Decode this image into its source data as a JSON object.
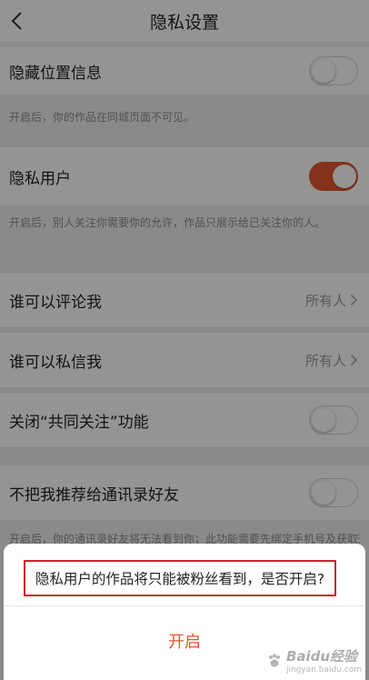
{
  "header": {
    "title": "隐私设置",
    "back_icon": "chevron-left-icon"
  },
  "settings": {
    "hide_location": {
      "label": "隐藏位置信息",
      "enabled": false,
      "hint": "开启后，你的作品在同城页面不可见。"
    },
    "private_user": {
      "label": "隐私用户",
      "enabled": true,
      "hint": "开启后，别人关注你需要你的允许，作品只展示给已关注你的人。"
    },
    "who_can_comment": {
      "label": "谁可以评论我",
      "value": "所有人"
    },
    "who_can_message": {
      "label": "谁可以私信我",
      "value": "所有人"
    },
    "close_mutual": {
      "label": "关闭“共同关注”功能",
      "enabled": false
    },
    "no_recommend_contacts": {
      "label": "不把我推荐给通讯录好友",
      "enabled": false,
      "hint": "开启后，你的通讯录好友将无法看到你；此功能需要先绑定手机号及获取通讯录权限才能开启。"
    }
  },
  "dialog": {
    "message": "隐私用户的作品将只能被粉丝看到，是否开启?",
    "confirm_label": "开启",
    "highlight_color": "#c8242c"
  },
  "watermark": {
    "text": "Baidu经验",
    "sub": "jingyan.baidu.com"
  },
  "colors": {
    "accent": "#e4562d",
    "background": "#eeeeee"
  }
}
